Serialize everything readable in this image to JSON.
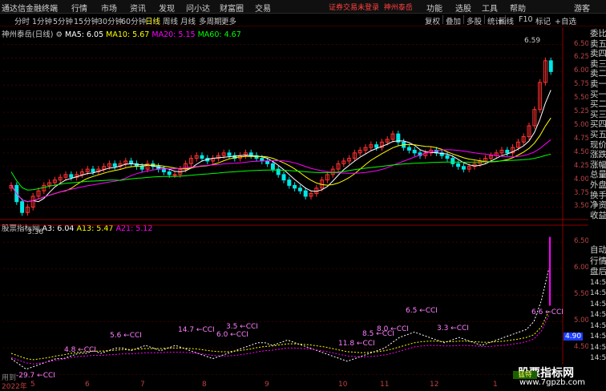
{
  "window": {
    "app_name": "通达信金融终端",
    "menu": [
      "行情",
      "市场",
      "资讯",
      "发现",
      "问小达",
      "财富圈",
      "交易"
    ],
    "warning": "证券交易未登录",
    "stock_name_top": "神州泰岳",
    "right_menu": [
      "功能",
      "选股",
      "工具",
      "帮助",
      "游客"
    ]
  },
  "period_tabs": {
    "items": [
      "分时",
      "1分钟",
      "5分钟",
      "15分钟",
      "30分钟",
      "60分钟",
      "日线",
      "周线",
      "月线",
      "多周期",
      "更多"
    ],
    "active": "日线"
  },
  "right_buttons": [
    "复权",
    "叠加",
    "多股",
    "统计",
    "画线",
    "F10",
    "标记",
    "+自选"
  ],
  "main_legend": {
    "title": "神州泰岳(日线)",
    "ma5": "MA5: 6.05",
    "ma10": "MA10: 5.67",
    "ma20": "MA20: 5.15",
    "ma60": "MA60: 4.67"
  },
  "sub_legend": {
    "title": "股票指标网",
    "a3": "A3: 6.04",
    "a13": "A13: 5.47",
    "a21": "A21: 5.12"
  },
  "side_panel": [
    "委比",
    "卖五",
    "卖四",
    "卖三",
    "卖二",
    "卖一",
    "买一",
    "买二",
    "买三",
    "买四",
    "买五",
    "现价",
    "涨跌",
    "涨幅",
    "总量",
    "外盘",
    "换手",
    "净资",
    "收益"
  ],
  "side_panel_lower": [
    "自动",
    "行情",
    "盘后",
    "14:50",
    "14:50",
    "14:50",
    "14:50",
    "14:50",
    "14:50",
    "14:50",
    "14:50",
    "14:50",
    "14:50"
  ],
  "price_axis_main": [
    "6.50",
    "6.25",
    "6.00",
    "5.75",
    "5.50",
    "5.25",
    "5.00",
    "4.75",
    "4.50",
    "4.25",
    "4.00",
    "3.75",
    "3.50"
  ],
  "price_axis_sub": [
    "6.50",
    "6.00",
    "5.50",
    "5.00",
    "4.50",
    "4.00"
  ],
  "sub_current_value": "4.90",
  "annotations_main": {
    "high": "6.59",
    "low": "3.36"
  },
  "cci_labels": [
    "4.8 ←CCI",
    "5.6 ←CCI",
    "14.7 ←CCI",
    "3.5 ←CCI",
    "6.0 ←CCI",
    "11.8 ←CCI",
    "8.5 ←CCI",
    "8.0 ←CCI",
    "6.5 ←CCI",
    "3.3 ←CCI",
    "6.6 ←CCI",
    "-29.7 ←CCI"
  ],
  "cci_prefix": "用到",
  "date_axis": [
    "2022年",
    "5",
    "6",
    "7",
    "8",
    "9",
    "10",
    "11",
    "12",
    "1"
  ],
  "bottom_marker": "猛特",
  "watermark": {
    "title": "股票指标网",
    "url": "www.7gpzb.com"
  },
  "colors": {
    "up": "#ff3232",
    "down": "#00e6e6",
    "ma5": "#ffffff",
    "ma10": "#ffff00",
    "ma20": "#ff00ff",
    "ma60": "#00ff00",
    "grid": "#3a0000",
    "axis": "#b44444"
  },
  "chart_data": {
    "type": "candlestick",
    "ylim": [
      3.3,
      6.7
    ],
    "closes": [
      3.9,
      3.6,
      3.4,
      3.5,
      3.7,
      3.8,
      3.9,
      3.95,
      4.0,
      4.05,
      4.1,
      4.05,
      4.1,
      4.15,
      4.2,
      4.15,
      4.2,
      4.25,
      4.3,
      4.25,
      4.3,
      4.35,
      4.3,
      4.25,
      4.2,
      4.3,
      4.25,
      4.2,
      4.15,
      4.1,
      4.1,
      4.2,
      4.3,
      4.4,
      4.45,
      4.4,
      4.35,
      4.4,
      4.45,
      4.5,
      4.45,
      4.4,
      4.45,
      4.5,
      4.45,
      4.4,
      4.35,
      4.3,
      4.2,
      4.1,
      4.0,
      3.9,
      3.85,
      3.8,
      3.7,
      3.75,
      3.85,
      4.0,
      4.1,
      4.2,
      4.3,
      4.35,
      4.4,
      4.5,
      4.55,
      4.6,
      4.65,
      4.6,
      4.7,
      4.75,
      4.85,
      4.7,
      4.6,
      4.55,
      4.5,
      4.45,
      4.5,
      4.55,
      4.5,
      4.45,
      4.4,
      4.3,
      4.25,
      4.2,
      4.25,
      4.3,
      4.35,
      4.4,
      4.45,
      4.5,
      4.55,
      4.5,
      4.6,
      4.7,
      4.8,
      5.0,
      5.3,
      5.8,
      6.2,
      6.0
    ],
    "sub_a3": [
      4.3,
      4.2,
      4.1,
      4.15,
      4.2,
      4.25,
      4.3,
      4.3,
      4.35,
      4.4,
      4.4,
      4.45,
      4.4,
      4.45,
      4.5,
      4.5,
      4.45,
      4.5,
      4.55,
      4.5,
      4.45,
      4.5,
      4.55,
      4.5,
      4.45,
      4.4,
      4.35,
      4.3,
      4.35,
      4.4,
      4.45,
      4.5,
      4.55,
      4.6,
      4.6,
      4.55,
      4.6,
      4.65,
      4.6,
      4.55,
      4.5,
      4.45,
      4.4,
      4.35,
      4.3,
      4.25,
      4.3,
      4.35,
      4.4,
      4.45,
      4.5,
      4.6,
      4.7,
      4.75,
      4.8,
      4.75,
      4.7,
      4.65,
      4.6,
      4.65,
      4.7,
      4.65,
      4.6,
      4.55,
      4.6,
      4.65,
      4.7,
      4.75,
      4.8,
      4.85,
      5.0,
      5.4,
      6.0
    ],
    "sub_a13": [
      4.4,
      4.35,
      4.3,
      4.28,
      4.3,
      4.32,
      4.35,
      4.37,
      4.4,
      4.42,
      4.43,
      4.44,
      4.44,
      4.45,
      4.46,
      4.47,
      4.47,
      4.48,
      4.49,
      4.49,
      4.49,
      4.5,
      4.5,
      4.5,
      4.49,
      4.48,
      4.46,
      4.44,
      4.43,
      4.43,
      4.44,
      4.46,
      4.48,
      4.51,
      4.53,
      4.54,
      4.56,
      4.58,
      4.58,
      4.57,
      4.56,
      4.54,
      4.52,
      4.49,
      4.46,
      4.43,
      4.42,
      4.41,
      4.42,
      4.43,
      4.45,
      4.48,
      4.52,
      4.56,
      4.6,
      4.62,
      4.63,
      4.63,
      4.62,
      4.62,
      4.63,
      4.63,
      4.62,
      4.61,
      4.61,
      4.62,
      4.63,
      4.65,
      4.67,
      4.7,
      4.75,
      4.9,
      5.2
    ],
    "sub_ylim": [
      3.9,
      6.7
    ]
  }
}
